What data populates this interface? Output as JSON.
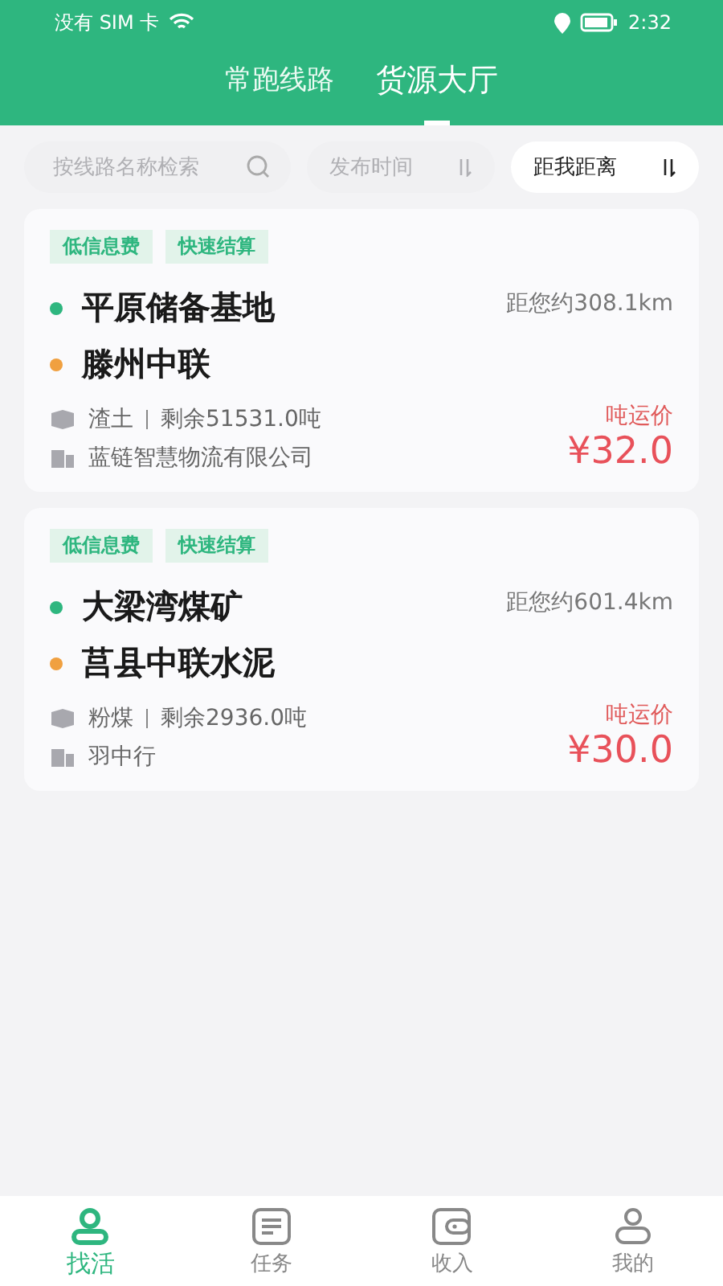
{
  "status_bar": {
    "carrier": "没有 SIM 卡",
    "time": "2:32"
  },
  "tabs": [
    {
      "label": "常跑线路",
      "selected": false
    },
    {
      "label": "货源大厅",
      "selected": true
    }
  ],
  "search": {
    "placeholder": "按线路名称检索"
  },
  "sorts": [
    {
      "label": "发布时间",
      "selected": false
    },
    {
      "label": "距我距离",
      "selected": true
    }
  ],
  "cards": [
    {
      "tags": [
        "低信息费",
        "快速结算"
      ],
      "from": "平原储备基地",
      "to": "滕州中联",
      "distance": "距您约308.1km",
      "cargo": "渣土",
      "remaining": "剩余51531.0吨",
      "company": "蓝链智慧物流有限公司",
      "price_label": "吨运价",
      "price": "¥32.0"
    },
    {
      "tags": [
        "低信息费",
        "快速结算"
      ],
      "from": "大梁湾煤矿",
      "to": "莒县中联水泥",
      "distance": "距您约601.4km",
      "cargo": "粉煤",
      "remaining": "剩余2936.0吨",
      "company": "羽中行",
      "price_label": "吨运价",
      "price": "¥30.0"
    }
  ],
  "nav": [
    {
      "label": "找活",
      "kind": "pin",
      "selected": true
    },
    {
      "label": "任务",
      "kind": "list",
      "selected": false
    },
    {
      "label": "收入",
      "kind": "wallet",
      "selected": false
    },
    {
      "label": "我的",
      "kind": "person",
      "selected": false
    }
  ]
}
